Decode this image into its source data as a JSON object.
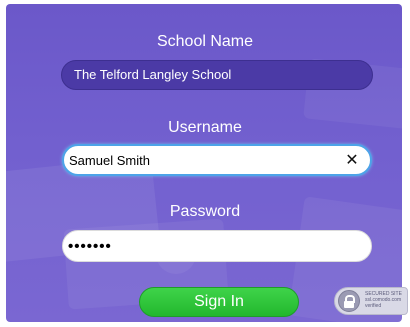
{
  "form": {
    "school_label": "School Name",
    "school_value": "The Telford Langley School",
    "username_label": "Username",
    "username_value": "Samuel Smith",
    "password_label": "Password",
    "password_value": "•••••••",
    "clear_icon": "✕",
    "signin_label": "Sign In"
  },
  "seal": {
    "title": "SECURED SITE",
    "line1": "ssl.comodo.com",
    "line2": "verified"
  },
  "icons": {
    "clear": "close-icon",
    "lock": "lock-icon"
  },
  "colors": {
    "panel_background": "#7260cf",
    "school_field": "#4b3aa6",
    "focus_border": "#4da3e8",
    "signin_button": "#2fc63a"
  }
}
